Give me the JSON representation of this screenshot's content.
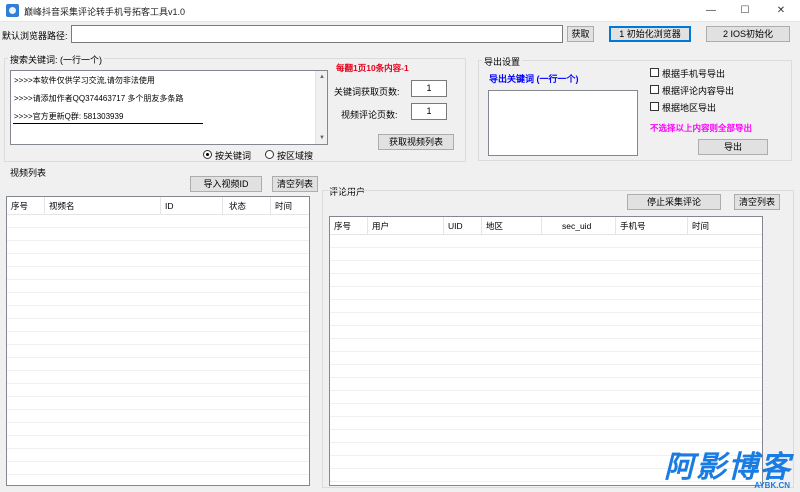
{
  "window": {
    "title": "巅峰抖音采集评论转手机号拓客工具v1.0",
    "minimize": "—",
    "maximize": "☐",
    "close": "✕"
  },
  "path_row": {
    "label": "默认浏览器路径:",
    "value": "",
    "fetch_button": "获取",
    "init_browser_button": "1 初始化浏览器",
    "ios_init_button": "2 IOS初始化"
  },
  "search": {
    "group_label": "搜索关键词: (一行一个)",
    "lines": [
      ">>>>本软件仅供学习交流,请勿非法使用",
      ">>>>请添加作者QQ374463717 多个朋友多条路",
      ">>>>官方更新Q群: 581303939"
    ],
    "notice": "每翻1页10条内容-1",
    "keyword_pages_label": "关键词获取页数:",
    "keyword_pages_value": "1",
    "comment_pages_label": "视频评论页数:",
    "comment_pages_value": "1",
    "get_video_list_button": "获取视频列表",
    "radio_keyword": "按关键词",
    "radio_region": "按区域搜"
  },
  "export": {
    "group_label": "导出设置",
    "keyword_header": "导出关键词  (一行一个)",
    "check_phone": "根据手机号导出",
    "check_comment": "根据评论内容导出",
    "check_region": "根据地区导出",
    "hint": "不选择以上内容则全部导出",
    "export_button": "导出"
  },
  "video_list": {
    "label": "视频列表",
    "import_button": "导入视频ID",
    "clear_button": "清空列表",
    "columns": [
      "序号",
      "视频名",
      "ID",
      "状态",
      "时间"
    ]
  },
  "comments": {
    "label": "评论用户",
    "stop_button": "停止采集评论",
    "clear_button": "清空列表",
    "columns": [
      "序号",
      "用户",
      "UID",
      "地区",
      "sec_uid",
      "手机号",
      "时间"
    ]
  },
  "watermark": {
    "main": "阿影博客",
    "sub": "AYBK.CN"
  }
}
